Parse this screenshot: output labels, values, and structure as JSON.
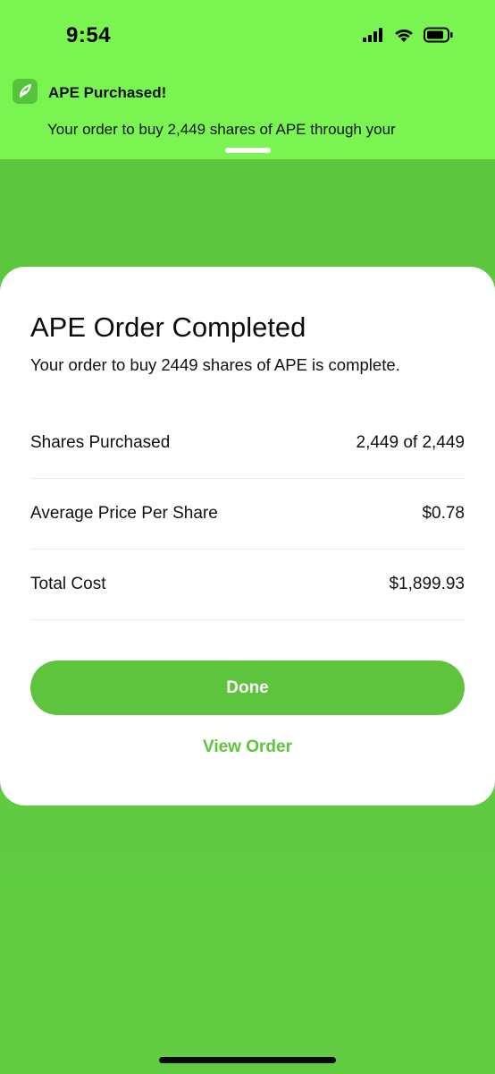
{
  "status_bar": {
    "time": "9:54",
    "icons": [
      "cellular-signal-icon",
      "wifi-icon",
      "battery-icon"
    ]
  },
  "notification": {
    "app_icon": "robinhood-feather-icon",
    "title": "APE Purchased!",
    "body": "Your order to buy 2,449 shares of APE through your"
  },
  "order_card": {
    "title": "APE Order Completed",
    "subtitle": "Your order to buy 2449 shares of APE is complete.",
    "details": [
      {
        "label": "Shares Purchased",
        "value": "2,449 of 2,449"
      },
      {
        "label": "Average Price Per Share",
        "value": "$0.78"
      },
      {
        "label": "Total Cost",
        "value": "$1,899.93"
      }
    ],
    "done_label": "Done",
    "view_order_label": "View Order"
  },
  "colors": {
    "accent": "#5ec43e",
    "banner": "#79f450",
    "background": "#5dc83f"
  }
}
